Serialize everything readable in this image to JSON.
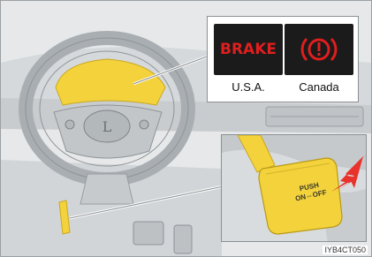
{
  "indicators": {
    "usa": {
      "display_text": "BRAKE",
      "region_label": "U.S.A.",
      "color": "#e01e1e"
    },
    "canada": {
      "icon": "brake-warning-icon",
      "region_label": "Canada",
      "color": "#e01e1e"
    }
  },
  "switch": {
    "label_line1": "PUSH",
    "label_line2": "ON⇔OFF"
  },
  "highlight_color": "#f3d23c",
  "arrow_color": "#e8322b",
  "figure_code": "IYB4CT050"
}
